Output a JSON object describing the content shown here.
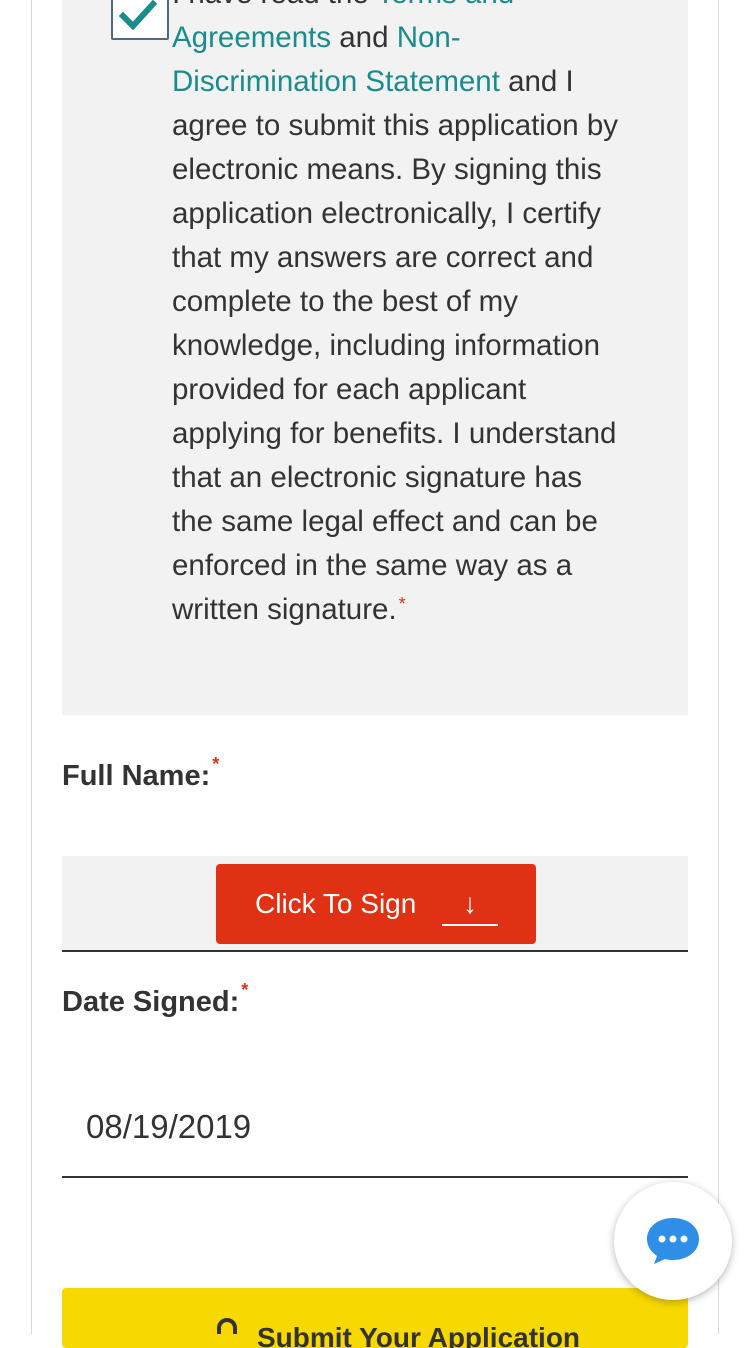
{
  "consent": {
    "text_prefix": "I have read the ",
    "link_terms": "Terms and Agreements",
    "text_and": " and ",
    "link_nondiscrimination": "Non-Discrimination Statement",
    "text_body": " and I agree to submit this application by electronic means. By signing this application electronically, I certify that my answers are correct and complete to the best of my knowledge, including information provided for each applicant applying for benefits. I understand that an electronic signature has the same legal effect and can be enforced in the same way as a written signature.",
    "required_marker": "*",
    "checked": true
  },
  "full_name": {
    "label": "Full Name:",
    "required_marker": "*",
    "sign_button_label": "Click To Sign",
    "sign_button_icon": "↓"
  },
  "date_signed": {
    "label": "Date Signed:",
    "required_marker": "*",
    "value": "08/19/2019"
  },
  "submit": {
    "label": "Submit Your Application",
    "icon": "lock-icon"
  },
  "chat": {
    "icon": "chat-bubble-icon"
  },
  "colors": {
    "link": "#1a8c8c",
    "required": "#e0301e",
    "sign_button": "#e03114",
    "submit_bar": "#f7d800",
    "panel": "#f2f2f2",
    "chat_icon": "#2f8fe8"
  }
}
